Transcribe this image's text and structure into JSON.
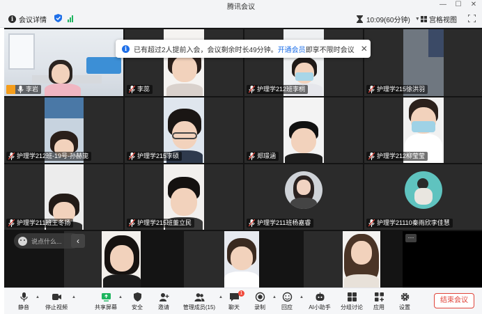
{
  "window": {
    "title": "腾讯会议",
    "controls": [
      "minimize",
      "maximize",
      "close"
    ]
  },
  "topbar": {
    "meeting_info_label": "会议详情",
    "duration_text": "10:09(60分钟)",
    "view_label": "宫格视图"
  },
  "notice": {
    "text_before": "已有超过2人提前入会，会议剩余时长49分钟。",
    "link_text": "开通会员",
    "text_after": "即享不限时会议"
  },
  "participants": [
    {
      "name": "李岩",
      "row": 1,
      "col": 1,
      "highlight": true,
      "host": true
    },
    {
      "name": "李蕊",
      "row": 1,
      "col": 2
    },
    {
      "name": "护理学212班李桐",
      "row": 1,
      "col": 3
    },
    {
      "name": "护理学215徐洪羽",
      "row": 1,
      "col": 4
    },
    {
      "name": "护理学212班-19号-孙赫旎",
      "row": 2,
      "col": 1
    },
    {
      "name": "护理学215李硕",
      "row": 2,
      "col": 2
    },
    {
      "name": "郑璟涵",
      "row": 2,
      "col": 3
    },
    {
      "name": "护理学212柳莹莹",
      "row": 2,
      "col": 4
    },
    {
      "name": "护理学211班王冬扬",
      "row": 3,
      "col": 1
    },
    {
      "name": "护理学215班董立民",
      "row": 3,
      "col": 2
    },
    {
      "name": "护理学211班杨嘉睿",
      "row": 3,
      "col": 3
    },
    {
      "name": "护理学21110秦雨欣李佳慧",
      "row": 3,
      "col": 4
    }
  ],
  "chat": {
    "placeholder": "说点什么..."
  },
  "toolbar": {
    "mute": "静音",
    "stop_video": "停止视频",
    "share_screen": "共享屏幕",
    "security": "安全",
    "invite": "邀请",
    "manage_members": "管理成员(15)",
    "chat": "聊天",
    "chat_badge": "1",
    "record": "录制",
    "reaction": "回应",
    "ai_assistant": "AI小助手",
    "breakout": "分组讨论",
    "apps": "应用",
    "settings": "设置",
    "end_meeting": "结束会议"
  },
  "colors": {
    "accent": "#1e6fe8",
    "active_speaker": "#23c45e",
    "end_button": "#e0443a",
    "host_badge": "#f59d1b"
  }
}
